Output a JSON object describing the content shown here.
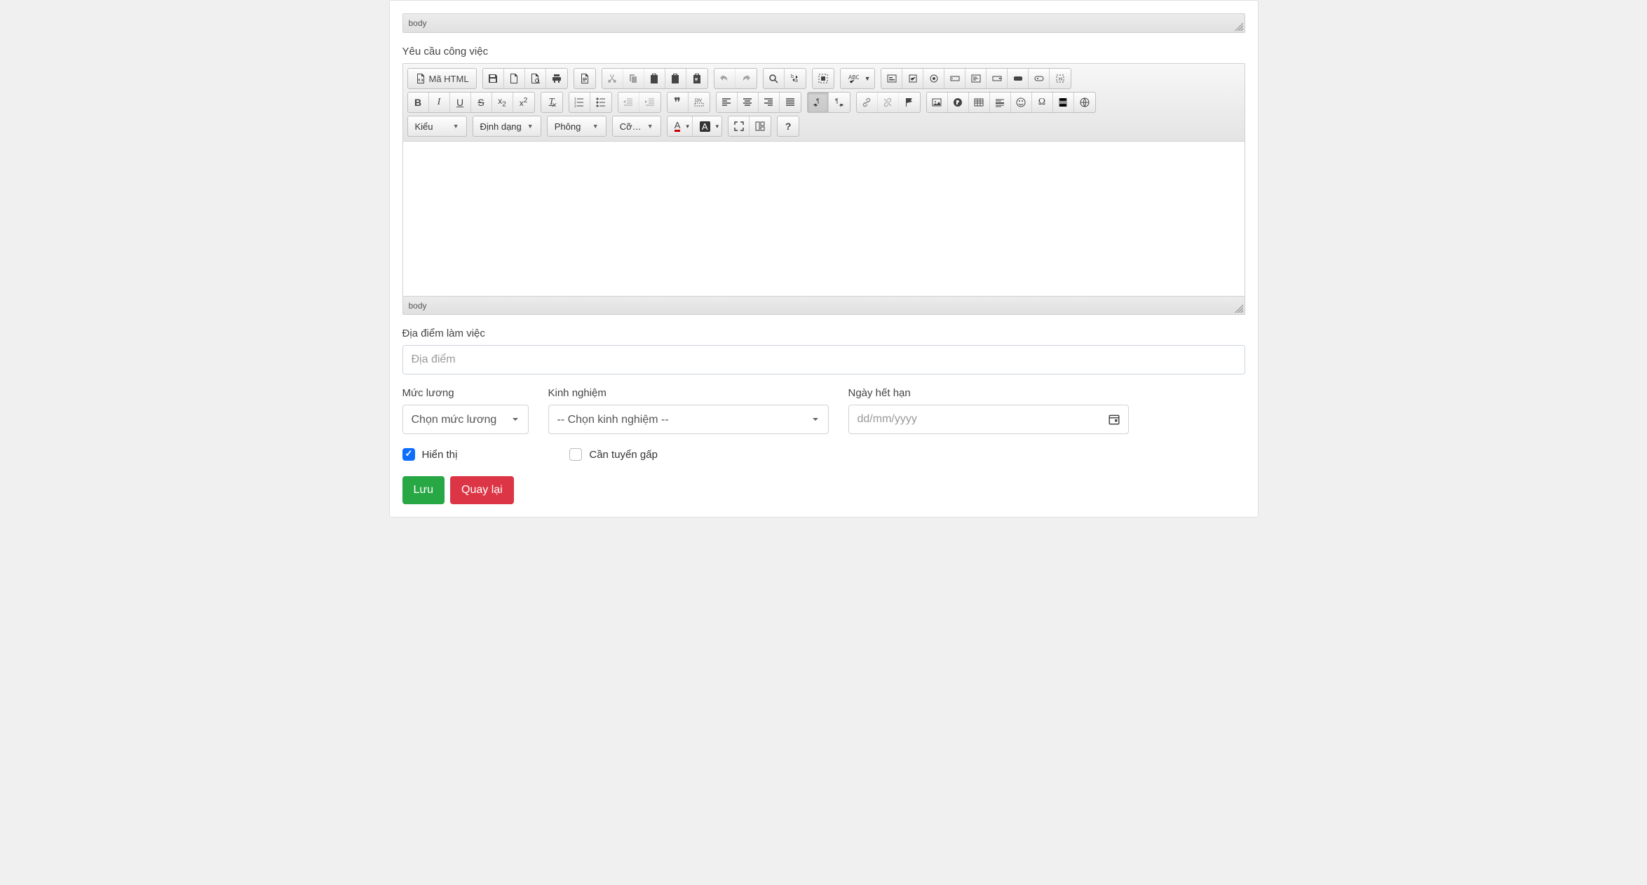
{
  "editor1": {
    "path": "body"
  },
  "section2": {
    "label": "Yêu cầu công việc",
    "toolbar": {
      "source_label": "Mã HTML",
      "styles_label": "Kiểu",
      "format_label": "Định dạng",
      "font_label": "Phông",
      "size_label": "Cỡ…"
    },
    "path": "body"
  },
  "location": {
    "label": "Địa điểm làm việc",
    "placeholder": "Địa điểm"
  },
  "salary": {
    "label": "Mức lương",
    "placeholder": "Chọn mức lương"
  },
  "experience": {
    "label": "Kinh nghiệm",
    "placeholder": "-- Chọn kinh nghiệm --"
  },
  "expiry": {
    "label": "Ngày hết hạn",
    "placeholder": "dd/mm/yyyy"
  },
  "checks": {
    "visible": "Hiển thị",
    "urgent": "Cần tuyển gấp"
  },
  "buttons": {
    "save": "Lưu",
    "back": "Quay lại"
  }
}
